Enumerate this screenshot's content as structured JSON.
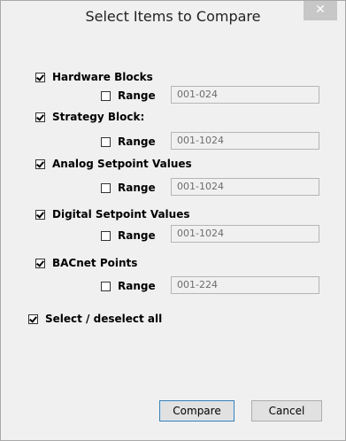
{
  "window": {
    "title": "Select Items to Compare",
    "close_glyph": "✕"
  },
  "items": [
    {
      "label": "Hardware Blocks",
      "checked": true,
      "range_label": "Range",
      "range_checked": false,
      "range_value": "001-024"
    },
    {
      "label": "Strategy Block:",
      "checked": true,
      "range_label": "Range",
      "range_checked": false,
      "range_value": "001-1024"
    },
    {
      "label": "Analog Setpoint Values",
      "checked": true,
      "range_label": "Range",
      "range_checked": false,
      "range_value": "001-1024"
    },
    {
      "label": "Digital Setpoint Values",
      "checked": true,
      "range_label": "Range",
      "range_checked": false,
      "range_value": "001-1024"
    },
    {
      "label": "BACnet Points",
      "checked": true,
      "range_label": "Range",
      "range_checked": false,
      "range_value": "001-224"
    }
  ],
  "select_all": {
    "label": "Select / deselect all",
    "checked": true
  },
  "buttons": {
    "compare": "Compare",
    "cancel": "Cancel"
  }
}
